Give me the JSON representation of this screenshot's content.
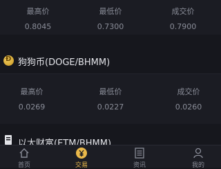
{
  "markets": [
    {
      "name": "",
      "stats": [
        {
          "label": "最高价",
          "value": "0.8045"
        },
        {
          "label": "最低价",
          "value": "0.7300"
        },
        {
          "label": "成交价",
          "value": "0.7900"
        }
      ]
    },
    {
      "name": "狗狗币(DOGE/BHMM)",
      "icon": "dogecoin-icon",
      "stats": [
        {
          "label": "最高价",
          "value": "0.0269"
        },
        {
          "label": "最低价",
          "value": "0.0227"
        },
        {
          "label": "成交价",
          "value": "0.0260"
        }
      ]
    },
    {
      "name": "以太财富(ETM/BHMM)",
      "icon": "document-icon"
    }
  ],
  "tabbar": {
    "tabs": [
      {
        "label": "首页",
        "icon": "home-icon"
      },
      {
        "label": "交易",
        "icon": "yen-icon",
        "active": true
      },
      {
        "label": "资讯",
        "icon": "news-icon"
      },
      {
        "label": "我的",
        "icon": "user-icon"
      }
    ]
  },
  "colors": {
    "background": "#16171d",
    "accent": "#e9b84a",
    "muted_text": "#8a8d98"
  }
}
